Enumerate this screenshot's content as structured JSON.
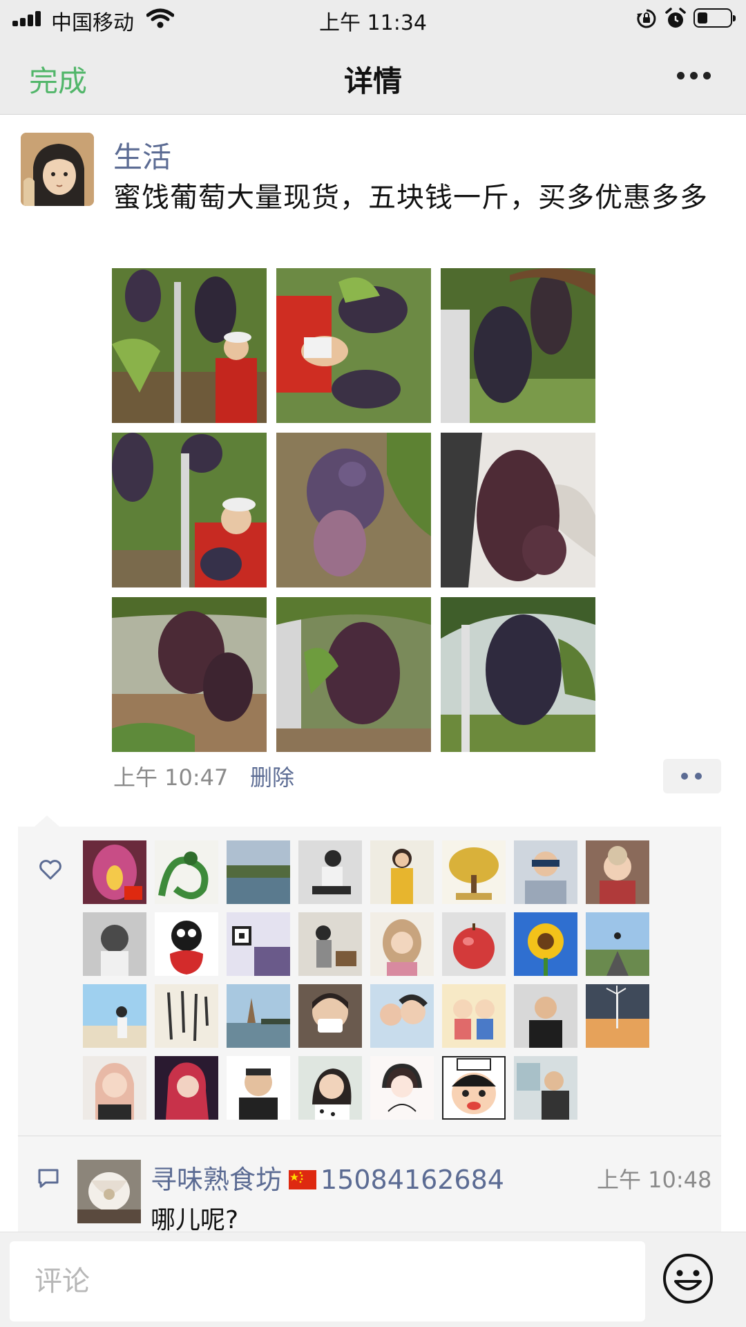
{
  "status_bar": {
    "carrier": "中国移动",
    "time": "上午 11:34",
    "icons": [
      "signal-icon",
      "wifi-icon",
      "orientation-lock-icon",
      "alarm-icon",
      "battery-icon"
    ]
  },
  "nav": {
    "done_label": "完成",
    "title": "详情",
    "more_icon": "more-icon"
  },
  "post": {
    "username": "生活",
    "text": "蜜饯葡萄大量现货，五块钱一斤，买多优惠多多",
    "photo_count": 9,
    "time": "上午 10:47",
    "delete_label": "删除",
    "action_icon": "more-dots-icon"
  },
  "likes": {
    "icon": "heart-icon",
    "count": 30
  },
  "comment": {
    "icon": "comment-icon",
    "author": "寻味熟食坊",
    "flag": "china-flag-icon",
    "phone": "15084162684",
    "time": "上午 10:48",
    "text": "哪儿呢?"
  },
  "input": {
    "placeholder": "评论",
    "emoji_icon": "emoji-icon"
  },
  "colors": {
    "link_blue": "#5b6b93",
    "done_green": "#52b66a",
    "bar_gray": "#ececec",
    "panel_gray": "#f5f5f5"
  }
}
